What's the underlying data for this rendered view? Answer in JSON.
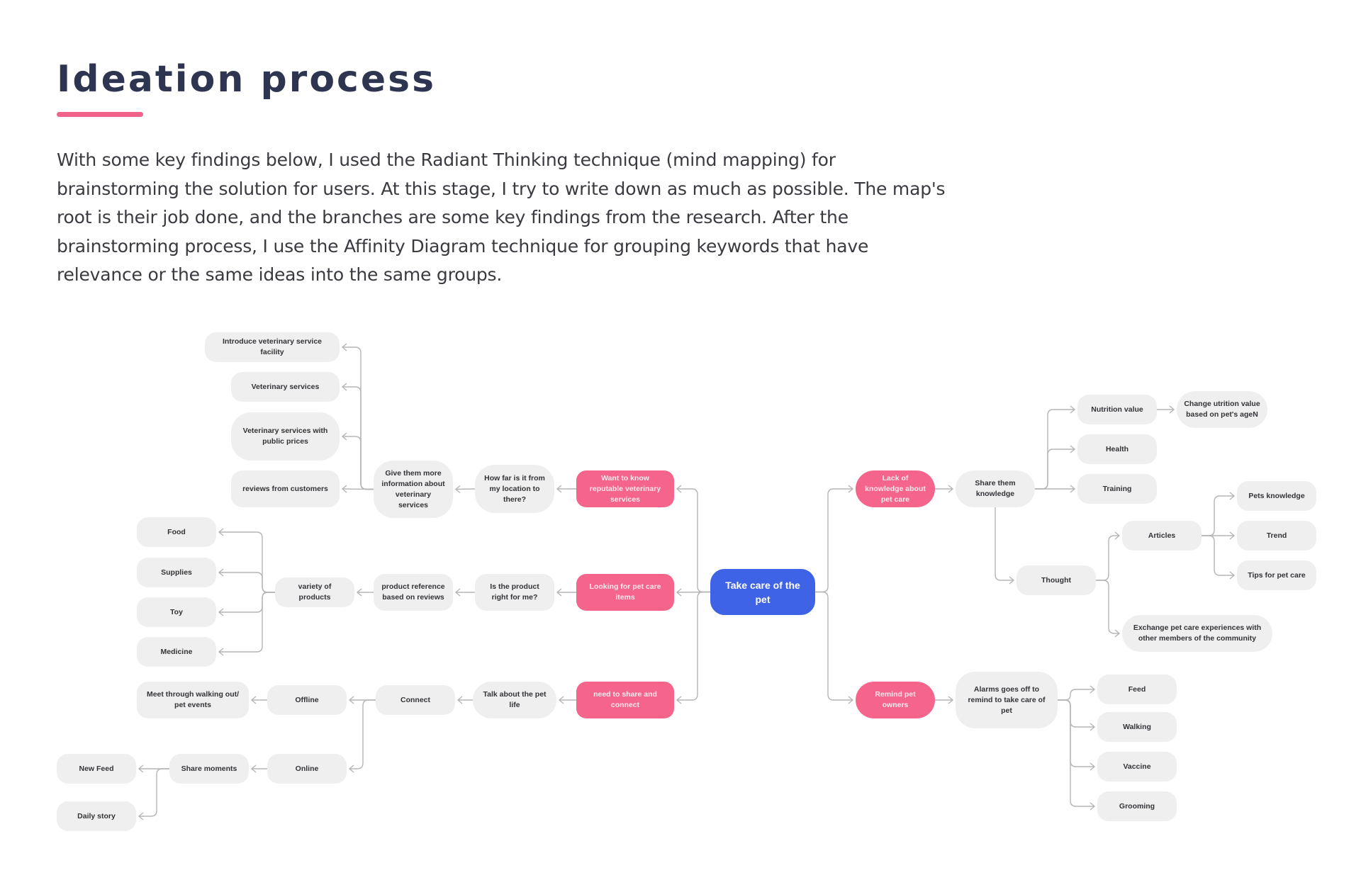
{
  "header": {
    "title": "Ideation process",
    "intro": "With some key findings below, I used the Radiant Thinking technique (mind mapping) for brainstorming the solution for users. At this stage, I try to write down as much as possible. The map's root is their job done, and the branches are some key findings from the research. After the brainstorming process, I use the Affinity Diagram technique for grouping keywords that have relevance or the same ideas into the same groups."
  },
  "colors": {
    "root": "#3F63E6",
    "finding": "#F4648B",
    "idea": "#EFEFEF",
    "title": "#2D3550",
    "accent_underline": "#F0628A",
    "connector": "#B5B5B5"
  },
  "mindmap": {
    "root": "Take care of the pet",
    "nodes": {
      "root": "Take care of the pet",
      "want_vet": "Want to know reputable veterinary services",
      "looking_items": "Looking for pet care items",
      "share_connect": "need to share and connect",
      "lack_knowledge": "Lack of knowledge about pet care",
      "remind": "Remind pet owners",
      "how_far": "How far is it from my location to there?",
      "give_info": "Give them more information about veterinary services",
      "intro_facility": "Introduce veterinary service facility",
      "vet_services": "Veterinary services",
      "vet_prices": "Veterinary services with public prices",
      "reviews": "reviews from customers",
      "product_right": "Is the product right for me?",
      "product_ref": "product reference based on reviews",
      "variety": "variety of products",
      "food": "Food",
      "supplies": "Supplies",
      "toy": "Toy",
      "medicine": "Medicine",
      "talk_pet": "Talk about the pet life",
      "connect": "Connect",
      "offline": "Offline",
      "meet": "Meet through walking out/ pet events",
      "online": "Online",
      "share_moments": "Share moments",
      "new_feed": "New Feed",
      "daily_story": "Daily story",
      "share_knowledge": "Share them knowledge",
      "nutrition": "Nutrition value",
      "change_nutrition": "Change utrition value based on pet's ageN",
      "health": "Health",
      "training": "Training",
      "thought": "Thought",
      "articles": "Articles",
      "pets_knowledge": "Pets knowledge",
      "trend": "Trend",
      "tips": "Tips for pet care",
      "exchange": "Exchange pet care experiences with other members of the community",
      "alarms": "Alarms goes off to remind to take care of pet",
      "feed": "Feed",
      "walking": "Walking",
      "vaccine": "Vaccine",
      "grooming": "Grooming"
    },
    "edges": [
      [
        "root",
        "want_vet"
      ],
      [
        "root",
        "looking_items"
      ],
      [
        "root",
        "share_connect"
      ],
      [
        "root",
        "lack_knowledge"
      ],
      [
        "root",
        "remind"
      ],
      [
        "want_vet",
        "how_far"
      ],
      [
        "how_far",
        "give_info"
      ],
      [
        "give_info",
        "intro_facility"
      ],
      [
        "give_info",
        "vet_services"
      ],
      [
        "give_info",
        "vet_prices"
      ],
      [
        "give_info",
        "reviews"
      ],
      [
        "looking_items",
        "product_right"
      ],
      [
        "product_right",
        "product_ref"
      ],
      [
        "product_ref",
        "variety"
      ],
      [
        "variety",
        "food"
      ],
      [
        "variety",
        "supplies"
      ],
      [
        "variety",
        "toy"
      ],
      [
        "variety",
        "medicine"
      ],
      [
        "share_connect",
        "talk_pet"
      ],
      [
        "talk_pet",
        "connect"
      ],
      [
        "connect",
        "offline"
      ],
      [
        "connect",
        "online"
      ],
      [
        "offline",
        "meet"
      ],
      [
        "online",
        "share_moments"
      ],
      [
        "share_moments",
        "new_feed"
      ],
      [
        "share_moments",
        "daily_story"
      ],
      [
        "lack_knowledge",
        "share_knowledge"
      ],
      [
        "share_knowledge",
        "nutrition"
      ],
      [
        "share_knowledge",
        "health"
      ],
      [
        "share_knowledge",
        "training"
      ],
      [
        "nutrition",
        "change_nutrition"
      ],
      [
        "share_knowledge",
        "thought"
      ],
      [
        "thought",
        "articles"
      ],
      [
        "thought",
        "exchange"
      ],
      [
        "articles",
        "pets_knowledge"
      ],
      [
        "articles",
        "trend"
      ],
      [
        "articles",
        "tips"
      ],
      [
        "remind",
        "alarms"
      ],
      [
        "alarms",
        "feed"
      ],
      [
        "alarms",
        "walking"
      ],
      [
        "alarms",
        "vaccine"
      ],
      [
        "alarms",
        "grooming"
      ]
    ]
  }
}
